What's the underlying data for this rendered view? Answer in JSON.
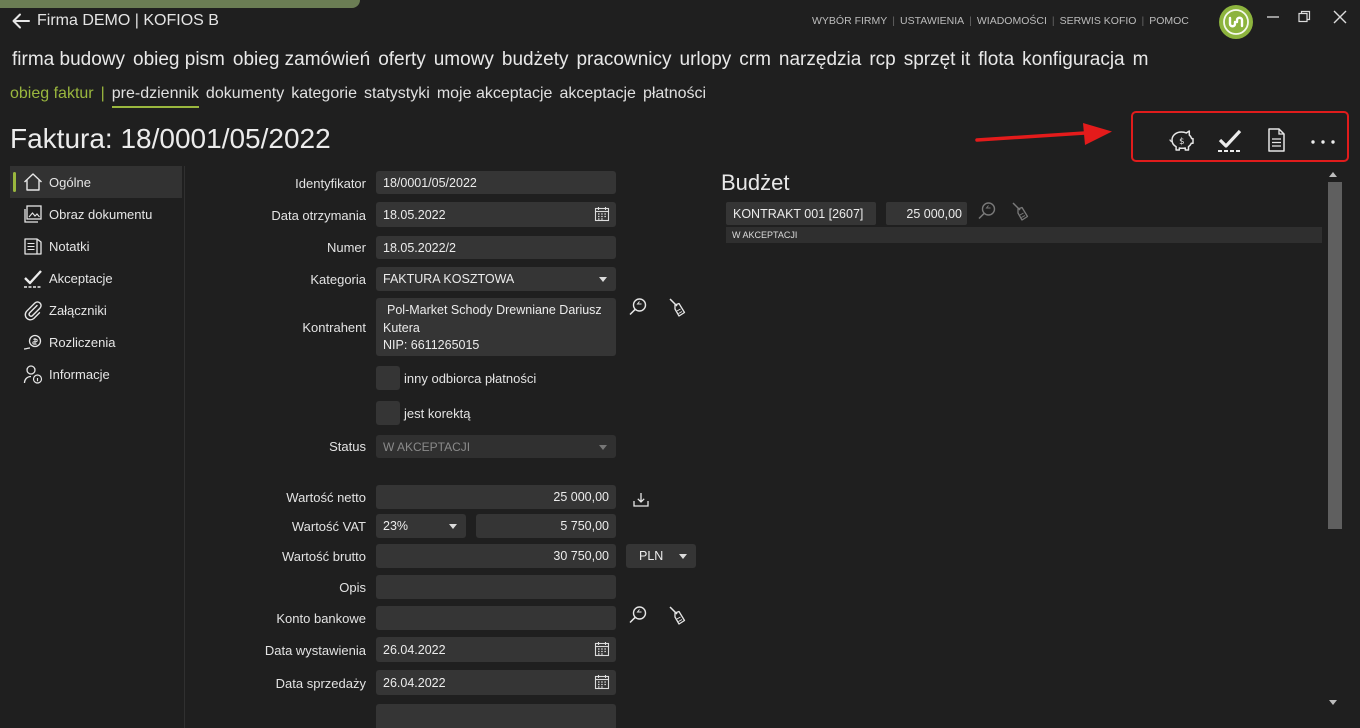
{
  "window": {
    "title": "Firma DEMO | KOFIOS B",
    "top_menu": [
      "WYBÓR FIRMY",
      "USTAWIENIA",
      "WIADOMOŚCI",
      "SERWIS KOFIO",
      "POMOC"
    ],
    "accent_color": "#9ab73e",
    "logo_color": "#8db43e"
  },
  "main_nav": [
    "firma budowy",
    "obieg pism",
    "obieg zamówień",
    "oferty",
    "umowy",
    "budżety",
    "pracownicy",
    "urlopy",
    "crm",
    "narzędzia",
    "rcp",
    "sprzęt it",
    "flota",
    "konfiguracja",
    "m"
  ],
  "sub_nav": {
    "module": "obieg faktur",
    "separator": "|",
    "items": [
      "pre-dziennik",
      "dokumenty",
      "kategorie",
      "statystyki",
      "moje akceptacje",
      "akceptacje",
      "płatności"
    ],
    "active": "pre-dziennik"
  },
  "page_title": "Faktura: 18/0001/05/2022",
  "toolbar": {
    "icons": [
      "piggy-bank-icon",
      "checkmark-icon",
      "document-icon",
      "more-icon"
    ],
    "highlight_color": "#e01c1c"
  },
  "sidebar": {
    "items": [
      {
        "label": "Ogólne",
        "icon": "home-icon"
      },
      {
        "label": "Obraz dokumentu",
        "icon": "image-icon"
      },
      {
        "label": "Notatki",
        "icon": "notes-icon"
      },
      {
        "label": "Akceptacje",
        "icon": "checkmark-icon"
      },
      {
        "label": "Załączniki",
        "icon": "paperclip-icon"
      },
      {
        "label": "Rozliczenia",
        "icon": "settlements-icon"
      },
      {
        "label": "Informacje",
        "icon": "user-info-icon"
      }
    ]
  },
  "form": {
    "identyfikator": {
      "label": "Identyfikator",
      "value": "18/0001/05/2022"
    },
    "data_otrzymania": {
      "label": "Data otrzymania",
      "value": "18.05.2022"
    },
    "numer": {
      "label": "Numer",
      "value": "18.05.2022/2"
    },
    "kategoria": {
      "label": "Kategoria",
      "value": "FAKTURA KOSZTOWA"
    },
    "kontrahent": {
      "label": "Kontrahent",
      "line1": "Pol-Market Schody Drewniane Dariusz",
      "line2": "Kutera",
      "line3": "NIP: 6611265015"
    },
    "inny_odbiorca": {
      "label": "inny odbiorca płatności",
      "checked": false
    },
    "jest_korekta": {
      "label": "jest korektą",
      "checked": false
    },
    "status": {
      "label": "Status",
      "value": "W AKCEPTACJI"
    },
    "wartosc_netto": {
      "label": "Wartość netto",
      "value": "25 000,00"
    },
    "wartosc_vat": {
      "label": "Wartość VAT",
      "rate": "23%",
      "value": "5 750,00"
    },
    "wartosc_brutto": {
      "label": "Wartość brutto",
      "value": "30 750,00",
      "currency": "PLN"
    },
    "opis": {
      "label": "Opis",
      "value": ""
    },
    "konto_bankowe": {
      "label": "Konto bankowe",
      "value": ""
    },
    "data_wystawienia": {
      "label": "Data wystawienia",
      "value": "26.04.2022"
    },
    "data_sprzedazy": {
      "label": "Data sprzedaży",
      "value": "26.04.2022"
    }
  },
  "budget": {
    "title": "Budżet",
    "rows": [
      {
        "name": "KONTRAKT 001 [2607]",
        "amount": "25 000,00",
        "status": "W AKCEPTACJI"
      }
    ]
  }
}
